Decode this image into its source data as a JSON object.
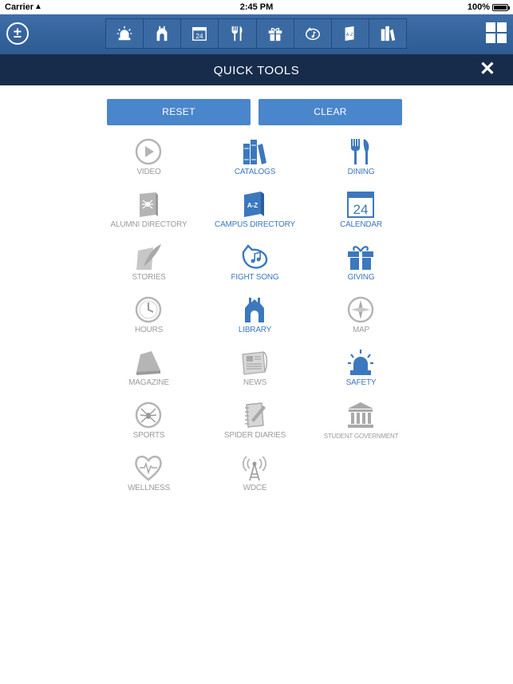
{
  "status_bar": {
    "carrier": "Carrier",
    "time": "2:45 PM",
    "battery": "100%"
  },
  "toolbar": {
    "left_icon": "plus-minus-icon",
    "shortcuts": [
      "safety-icon",
      "library-icon",
      "calendar-icon",
      "dining-icon",
      "giving-icon",
      "fight-song-icon",
      "campus-directory-icon",
      "catalogs-icon"
    ],
    "calendar_day": "24",
    "right_icon": "grid-icon"
  },
  "header": {
    "title": "QUICK TOOLS",
    "close": "✕"
  },
  "actions": {
    "reset": "RESET",
    "clear": "CLEAR"
  },
  "tools": [
    {
      "label": "VIDEO",
      "icon": "video-icon",
      "active": false
    },
    {
      "label": "CATALOGS",
      "icon": "catalogs-icon",
      "active": true
    },
    {
      "label": "DINING",
      "icon": "dining-icon",
      "active": true
    },
    {
      "label": "ALUMNI DIRECTORY",
      "icon": "alumni-directory-icon",
      "active": false
    },
    {
      "label": "CAMPUS DIRECTORY",
      "icon": "campus-directory-icon",
      "active": true
    },
    {
      "label": "CALENDAR",
      "icon": "calendar-icon",
      "active": true,
      "day": "24"
    },
    {
      "label": "STORIES",
      "icon": "stories-icon",
      "active": false
    },
    {
      "label": "FIGHT SONG",
      "icon": "fight-song-icon",
      "active": true
    },
    {
      "label": "GIVING",
      "icon": "giving-icon",
      "active": true
    },
    {
      "label": "HOURS",
      "icon": "clock-icon",
      "active": false
    },
    {
      "label": "LIBRARY",
      "icon": "library-icon",
      "active": true
    },
    {
      "label": "MAP",
      "icon": "compass-icon",
      "active": false
    },
    {
      "label": "MAGAZINE",
      "icon": "magazine-icon",
      "active": false
    },
    {
      "label": "NEWS",
      "icon": "news-icon",
      "active": false
    },
    {
      "label": "SAFETY",
      "icon": "safety-icon",
      "active": true
    },
    {
      "label": "SPORTS",
      "icon": "spider-icon",
      "active": false
    },
    {
      "label": "SPIDER DIARIES",
      "icon": "notebook-icon",
      "active": false
    },
    {
      "label": "STUDENT GOVERNMENT",
      "icon": "government-icon",
      "active": false
    },
    {
      "label": "WELLNESS",
      "icon": "heart-icon",
      "active": false
    },
    {
      "label": "WDCE",
      "icon": "tower-icon",
      "active": false
    }
  ],
  "colors": {
    "toolbar": "#3e6ea8",
    "header": "#172c4b",
    "button": "#4a86cb",
    "active": "#3c78be",
    "inactive": "#9c9c9c"
  }
}
